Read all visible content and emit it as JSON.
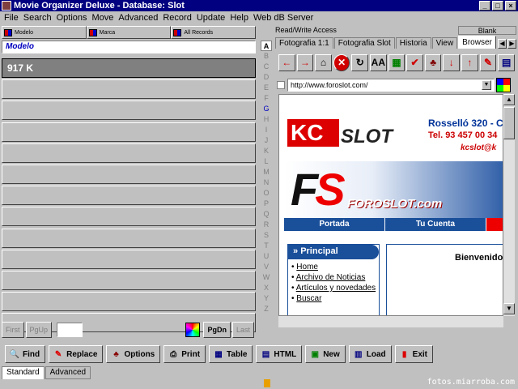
{
  "window": {
    "title": "Movie Organizer Deluxe - Database: Slot",
    "min_label": "_",
    "max_label": "□",
    "close_label": "×"
  },
  "menu": [
    "File",
    "Search",
    "Options",
    "Move",
    "Advanced",
    "Record",
    "Update",
    "Help",
    "Web dB Server"
  ],
  "sort_buttons": [
    "Modelo",
    "Marca",
    "All Records"
  ],
  "field_label": "Modelo",
  "records": [
    "917 K",
    "",
    "",
    "",
    "",
    "",
    "",
    "",
    "",
    "",
    "",
    "",
    ""
  ],
  "alphabet": [
    "A",
    "B",
    "C",
    "D",
    "E",
    "F",
    "G",
    "H",
    "I",
    "J",
    "K",
    "L",
    "M",
    "N",
    "O",
    "P",
    "Q",
    "R",
    "S",
    "T",
    "U",
    "V",
    "W",
    "X",
    "Y",
    "Z"
  ],
  "alphabet_active": "A",
  "alphabet_highlight": "G",
  "nav": {
    "first": "First",
    "pgup": "PgUp",
    "pgdn": "PgDn",
    "last": "Last",
    "page_value": ""
  },
  "access": {
    "label": "Read/Write Access",
    "blank": "Blank"
  },
  "tabs": [
    "Fotografia 1:1",
    "Fotografia Slot",
    "Historia",
    "View",
    "Browser"
  ],
  "active_tab": "Browser",
  "browser_toolbar": [
    {
      "name": "back-arrow-icon",
      "glyph": "←",
      "color": "#d00000"
    },
    {
      "name": "forward-arrow-icon",
      "glyph": "→",
      "color": "#d00000"
    },
    {
      "name": "home-icon",
      "glyph": "⌂",
      "color": "#000000"
    },
    {
      "name": "stop-icon",
      "glyph": "✕",
      "color": "#ffffff"
    },
    {
      "name": "refresh-icon",
      "glyph": "↻",
      "color": "#000000"
    },
    {
      "name": "font-size-icon",
      "glyph": "AA",
      "color": "#000000"
    },
    {
      "name": "colors-icon",
      "glyph": "▦",
      "color": "#008000"
    },
    {
      "name": "check-icon",
      "glyph": "✔",
      "color": "#d00000"
    },
    {
      "name": "tree-icon",
      "glyph": "♣",
      "color": "#800000"
    },
    {
      "name": "sort-down-icon",
      "glyph": "↓",
      "color": "#d00000"
    },
    {
      "name": "sort-up-icon",
      "glyph": "↑",
      "color": "#d00000"
    },
    {
      "name": "edit-icon",
      "glyph": "✎",
      "color": "#d00000"
    },
    {
      "name": "grid-icon",
      "glyph": "▤",
      "color": "#000080"
    }
  ],
  "url": "http://www.foroslot.com/",
  "webpage": {
    "kc_text": "KC",
    "slot_text": "SLOT",
    "address": "Rosselló 320 - C",
    "phone": "Tel. 93 457 00 34",
    "email": "kcslot@k",
    "fs_text": "F",
    "fs_s": "S",
    "foroslot": "FOROSLOT.com",
    "nav": [
      "Portada",
      "Tu Cuenta",
      ""
    ],
    "menu_header": "Principal",
    "menu_items": [
      "Home",
      "Archivo de Noticias",
      "Artículos y novedades",
      "Buscar"
    ],
    "welcome": "Bienvenido"
  },
  "toolbar": [
    "Find",
    "Replace",
    "Options",
    "Print",
    "Table",
    "HTML",
    "New",
    "Load",
    "Exit"
  ],
  "bottom_tabs": [
    "Standard",
    "Advanced"
  ],
  "footer": "fotos.miarroba.com"
}
